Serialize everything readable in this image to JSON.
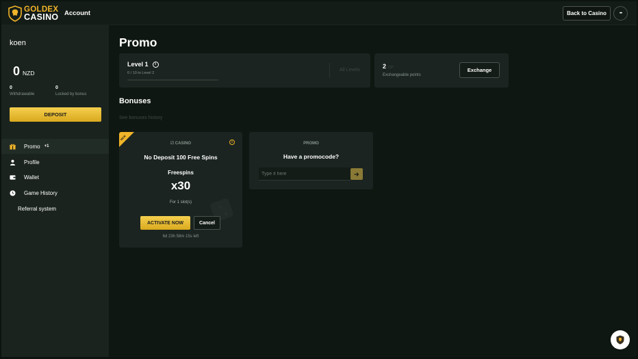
{
  "header": {
    "logo_line1": "GOLDEX",
    "logo_line2": "CASINO",
    "account_label": "Account",
    "back_label": "Back to Casino",
    "more_label": "•••"
  },
  "sidebar": {
    "username": "koen",
    "balance": "0",
    "currency": "NZD",
    "withdrawable_value": "0",
    "withdrawable_label": "Withdrawable",
    "locked_value": "0",
    "locked_label": "Locked by bonus",
    "deposit_label": "DEPOSIT",
    "items": [
      {
        "label": "Promo",
        "badge": "+1",
        "icon": "gift-icon"
      },
      {
        "label": "Profile",
        "icon": "user-icon"
      },
      {
        "label": "Wallet",
        "icon": "wallet-icon"
      },
      {
        "label": "Game History",
        "icon": "clock-icon"
      },
      {
        "label": "Referral system"
      }
    ]
  },
  "main": {
    "title": "Promo",
    "level": {
      "title": "Level 1",
      "info": "i",
      "progress_text": "0 / 10 to Level 2",
      "progress": 0,
      "all_levels": "All Levels"
    },
    "points": {
      "value": "2",
      "unit": "CP",
      "label": "Exchangeable points",
      "exchange_label": "Exchange"
    },
    "bonuses_title": "Bonuses",
    "history_link": "See bonuses history",
    "bonus": {
      "ribbon": "NEW",
      "category": "CASINO",
      "info": "i",
      "name": "No Deposit 100 Free Spins",
      "type": "Freespins",
      "multiplier": "x30",
      "condition": "For 1 slot(s)",
      "activate_label": "ACTIVATE NOW",
      "cancel_label": "Cancel",
      "timer": "6d 23h 58m 15s left"
    },
    "promo": {
      "category": "PROMO",
      "question": "Have a promocode?",
      "placeholder": "Type it here"
    }
  },
  "colors": {
    "accent": "#f0b429",
    "background": "#0f1712",
    "sidebar": "#1a231e",
    "card": "#1b2420"
  }
}
